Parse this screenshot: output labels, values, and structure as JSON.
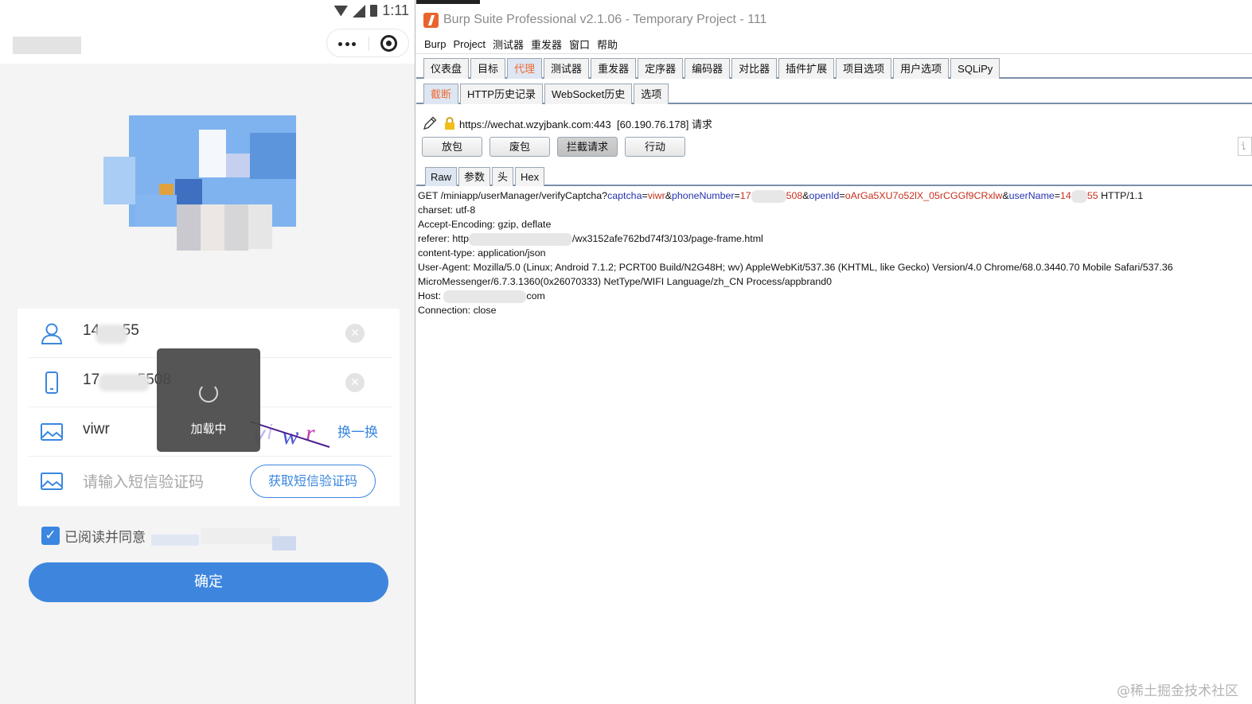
{
  "phone": {
    "status": {
      "time": "1:11"
    },
    "form": {
      "username": "14   55",
      "phone": "17     5508",
      "captcha_value": "viwr",
      "captcha_refresh": "换一换",
      "sms_placeholder": "请输入短信验证码",
      "sms_button": "获取短信验证码"
    },
    "agree_text": "已阅读并同意",
    "confirm_label": "确定",
    "loading_text": "加载中"
  },
  "burp": {
    "title": "Burp Suite Professional v2.1.06 - Temporary Project - 111",
    "menu": [
      "Burp",
      "Project",
      "测试器",
      "重发器",
      "窗口",
      "帮助"
    ],
    "main_tabs": [
      "仪表盘",
      "目标",
      "代理",
      "测试器",
      "重发器",
      "定序器",
      "编码器",
      "对比器",
      "插件扩展",
      "项目选项",
      "用户选项",
      "SQLiPy"
    ],
    "main_tab_active": "代理",
    "proxy_tabs": [
      "截断",
      "HTTP历史记录",
      "WebSocket历史",
      "选项"
    ],
    "proxy_tab_active": "截断",
    "request_url": "https://wechat.wzyjbank.com:443",
    "request_ip": "[60.190.76.178]",
    "request_suffix": "请求",
    "buttons": [
      "放包",
      "废包",
      "拦截请求",
      "行动"
    ],
    "buttons_pressed": "拦截请求",
    "editor_tabs": [
      "Raw",
      "参数",
      "头",
      "Hex"
    ],
    "editor_tab_active": "Raw",
    "side_edge_char": "讠",
    "request": {
      "get_prefix": "GET /miniapp/userManager/verifyCaptcha?",
      "p_captcha": "captcha",
      "v_captcha": "viwr",
      "amp": "&",
      "eq": "=",
      "p_phone": "phoneNumber",
      "v_phone_a": "17",
      "v_phone_b": "508",
      "p_openid": "openId",
      "v_openid": "oArGa5XU7o52lX_05rCGGf9CRxlw",
      "p_username": "userName",
      "v_user_a": "14",
      "v_user_b": "55",
      "http_version": " HTTP/1.1",
      "charset": "charset: utf-8",
      "accept_encoding": "Accept-Encoding: gzip, deflate",
      "referer_a": "referer: http",
      "referer_b": "/wx3152afe762bd74f3/103/page-frame.html",
      "content_type": "content-type: application/json",
      "user_agent_1": "User-Agent: Mozilla/5.0 (Linux; Android 7.1.2; PCRT00 Build/N2G48H; wv) AppleWebKit/537.36 (KHTML, like Gecko) Version/4.0 Chrome/68.0.3440.70 Mobile Safari/537.36",
      "user_agent_2": "MicroMessenger/6.7.3.1360(0x26070333) NetType/WIFI Language/zh_CN Process/appbrand0",
      "host_a": "Host: ",
      "host_b": "com",
      "connection": "Connection: close"
    }
  },
  "watermark": "@稀土掘金技术社区",
  "colors": {
    "accent_blue": "#3e86dd",
    "burp_orange": "#ef6a34",
    "param_blue": "#2433b0",
    "value_red": "#c8301e"
  }
}
